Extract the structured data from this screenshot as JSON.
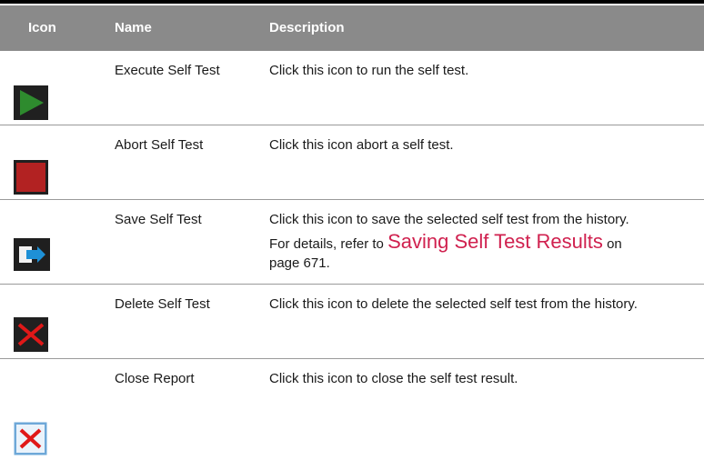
{
  "header": {
    "icon": "Icon",
    "name": "Name",
    "description": "Description"
  },
  "rows": [
    {
      "icon": "play-icon",
      "name": "Execute Self Test",
      "description": "Click this icon to run the self test."
    },
    {
      "icon": "stop-icon",
      "name": "Abort Self Test",
      "description": "Click this icon abort a self test."
    },
    {
      "icon": "save-export-icon",
      "name": "Save Self Test",
      "description_line1": "Click this icon to save the selected self test from the history.",
      "description_line2_prefix": "For details, refer to",
      "description_link": "Saving Self Test Results",
      "description_line2_suffix": "on",
      "description_line3": "page 671."
    },
    {
      "icon": "delete-x-icon",
      "name": "Delete Self Test",
      "description": "Click this icon to delete the selected self test from the history."
    },
    {
      "icon": "close-x-icon",
      "name": "Close Report",
      "description": "Click this icon to close the self test result."
    }
  ],
  "colors": {
    "header_bg": "#8a8a8a",
    "play_green": "#2e8b2e",
    "stop_red": "#b22222",
    "link_pink": "#d0214f",
    "icon_bg_dark": "#1f1f1f"
  }
}
